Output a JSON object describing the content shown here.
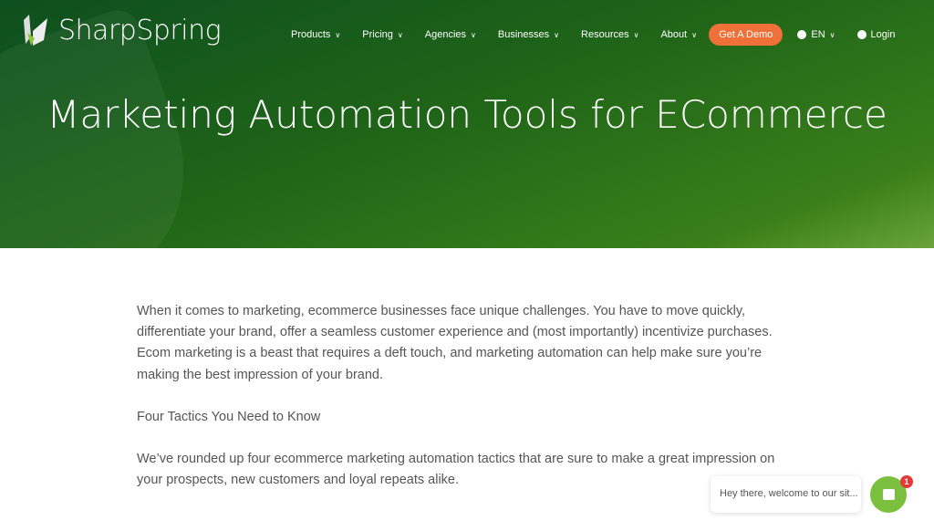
{
  "brand": {
    "name": "SharpSpring"
  },
  "nav": {
    "items": [
      {
        "label": "Products"
      },
      {
        "label": "Pricing"
      },
      {
        "label": "Agencies"
      },
      {
        "label": "Businesses"
      },
      {
        "label": "Resources"
      },
      {
        "label": "About"
      }
    ],
    "demo_label": "Get A Demo",
    "language": "EN",
    "login": "Login"
  },
  "hero": {
    "title": "Marketing Automation Tools for ECommerce"
  },
  "content": {
    "paragraphs": [
      "When it comes to marketing, ecommerce businesses face unique challenges. You have to move quickly, differentiate your brand, offer a seamless customer experience and (most importantly) incentivize purchases. Ecom marketing is a beast that requires a deft touch, and marketing automation can help make sure you’re making the best impression of your brand.",
      "Four Tactics You Need to Know",
      "We’ve rounded up four ecommerce marketing automation tactics that are sure to make a great impression on your prospects, new customers and loyal repeats alike."
    ]
  },
  "chat": {
    "message": "Hey there, welcome to our sit...",
    "badge": "1"
  },
  "colors": {
    "accent": "#f0703a",
    "chat": "#7bbf3e"
  }
}
